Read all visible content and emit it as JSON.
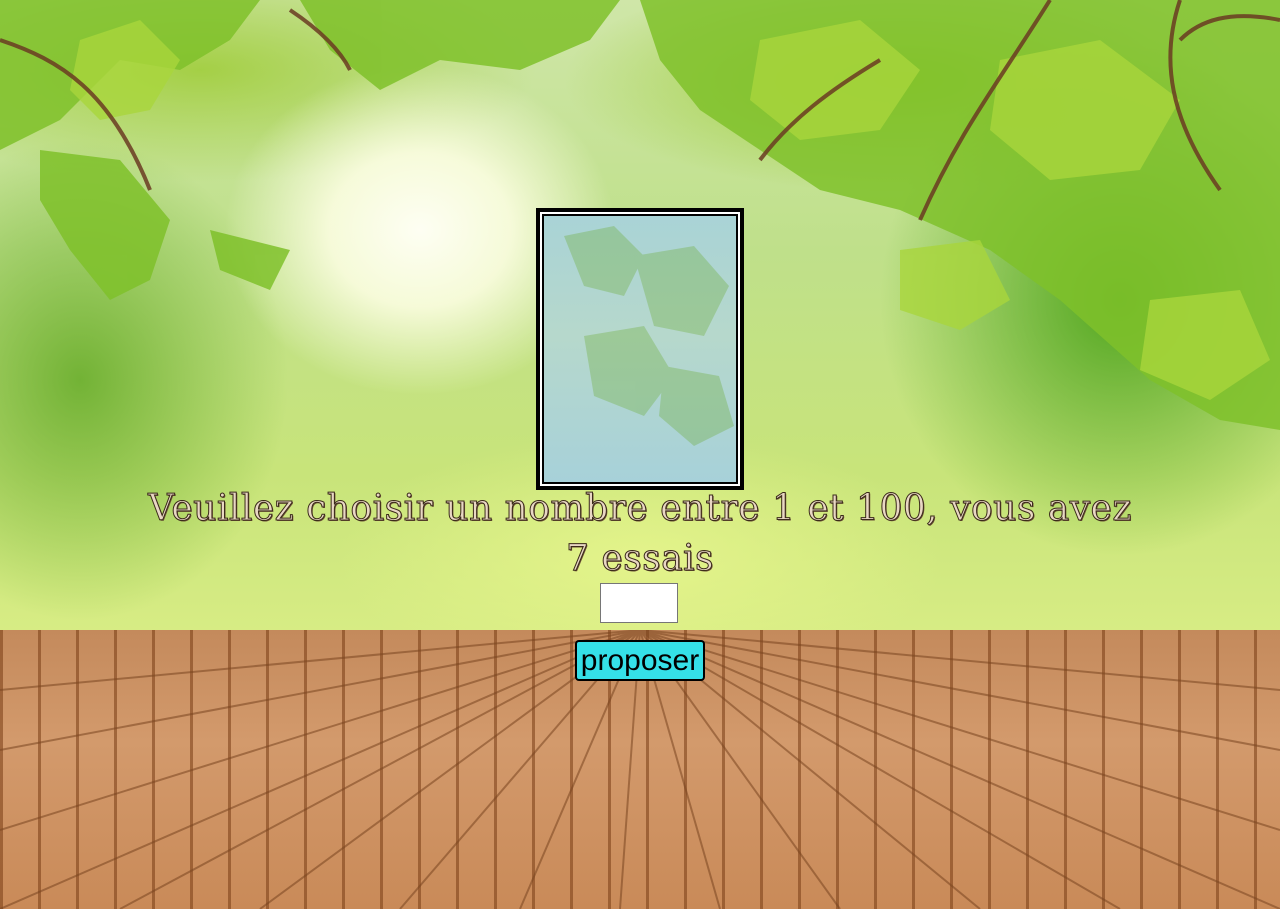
{
  "game": {
    "prompt": "Veuillez choisir un nombre entre 1 et 100, vous avez 7 essais",
    "input_value": "",
    "input_placeholder": "",
    "submit_label": "proposer"
  },
  "colors": {
    "button_background": "#35e0e8",
    "frame_border": "#000000"
  }
}
